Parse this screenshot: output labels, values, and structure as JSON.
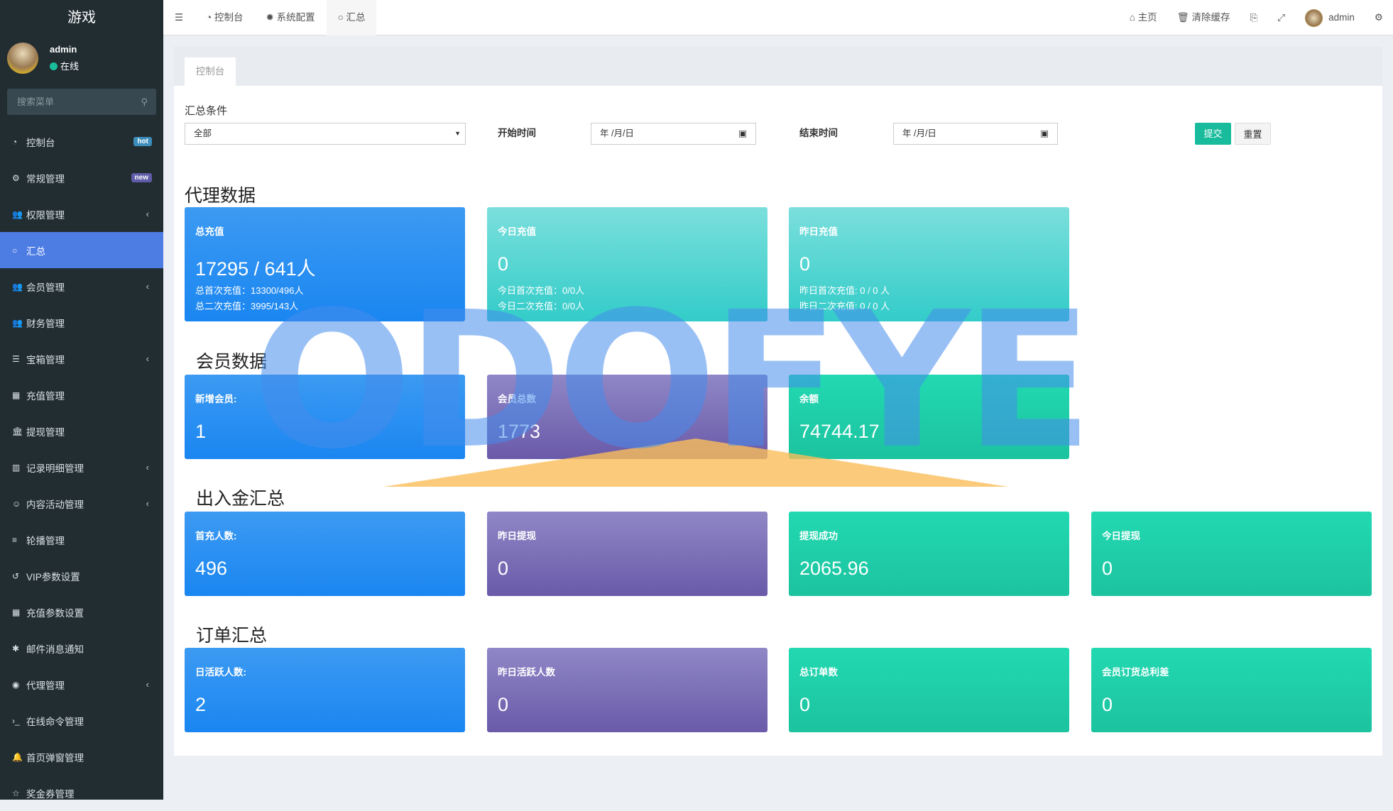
{
  "sidebar": {
    "app_title": "游戏",
    "user": "admin",
    "status": "在线",
    "search_placeholder": "搜索菜单",
    "items": [
      {
        "label": "控制台",
        "icon": "dashboard-icon",
        "badge": "hot",
        "badge_color": "#3c8dbc"
      },
      {
        "label": "常规管理",
        "icon": "cogs-icon",
        "badge": "new",
        "badge_color": "#605ca8"
      },
      {
        "label": "权限管理",
        "icon": "group-icon",
        "chevron": "‹"
      },
      {
        "label": "汇总",
        "icon": "circle-icon",
        "active": true
      },
      {
        "label": "会员管理",
        "icon": "users-icon",
        "chevron": "‹"
      },
      {
        "label": "财务管理",
        "icon": "users-icon"
      },
      {
        "label": "宝箱管理",
        "icon": "list-icon",
        "chevron": "‹"
      },
      {
        "label": "充值管理",
        "icon": "grid-icon"
      },
      {
        "label": "提现管理",
        "icon": "bank-icon"
      },
      {
        "label": "记录明细管理",
        "icon": "bar-chart-icon",
        "chevron": "‹"
      },
      {
        "label": "内容活动管理",
        "icon": "smile-icon",
        "chevron": "‹"
      },
      {
        "label": "轮播管理",
        "icon": "bars-icon"
      },
      {
        "label": "VIP参数设置",
        "icon": "history-icon"
      },
      {
        "label": "充值参数设置",
        "icon": "th-icon"
      },
      {
        "label": "邮件消息通知",
        "icon": "asterisk-icon"
      },
      {
        "label": "代理管理",
        "icon": "user-circle-icon",
        "chevron": "‹"
      },
      {
        "label": "在线命令管理",
        "icon": "terminal-icon"
      },
      {
        "label": "首页弹窗管理",
        "icon": "bell-icon"
      },
      {
        "label": "奖金券管理",
        "icon": "star-icon"
      }
    ]
  },
  "topbar": {
    "tabs": [
      {
        "label": "控制台"
      },
      {
        "label": "系统配置"
      },
      {
        "label": "汇总",
        "active": true
      }
    ],
    "home": "主页",
    "clear_cache": "清除缓存",
    "user": "admin"
  },
  "panel": {
    "tab": "控制台"
  },
  "filter": {
    "label": "汇总条件",
    "select_value": "全部",
    "start_label": "开始时间",
    "start_placeholder": "年 /月/日",
    "end_label": "结束时间",
    "end_placeholder": "年 /月/日",
    "submit": "提交",
    "reset": "重置"
  },
  "sections": {
    "agent": {
      "title": "代理数据",
      "cards": [
        {
          "title": "总充值",
          "value": "17295 / 641人",
          "sub1": "总首次充值：13300/496人",
          "sub2": "总二次充值：3995/143人"
        },
        {
          "title": "今日充值",
          "value": "0",
          "sub1": "今日首次充值：0/0人",
          "sub2": "今日二次充值：0/0人"
        },
        {
          "title": "昨日充值",
          "value": "0",
          "sub1": "昨日首次充值: 0 / 0 人",
          "sub2": "昨日二次充值: 0 / 0 人"
        }
      ]
    },
    "member": {
      "title": "会员数据",
      "cards": [
        {
          "title": "新增会员:",
          "value": "1"
        },
        {
          "title": "会员总数",
          "value": "1773"
        },
        {
          "title": "余额",
          "value": "74744.17"
        }
      ]
    },
    "cash": {
      "title": "出入金汇总",
      "cards": [
        {
          "title": "首充人数:",
          "value": "496"
        },
        {
          "title": "昨日提现",
          "value": "0"
        },
        {
          "title": "提现成功",
          "value": "2065.96"
        },
        {
          "title": "今日提现",
          "value": "0"
        }
      ]
    },
    "orders": {
      "title": "订单汇总",
      "cards": [
        {
          "title": "日活跃人数:",
          "value": "2"
        },
        {
          "title": "昨日活跃人数",
          "value": "0"
        },
        {
          "title": "总订单数",
          "value": "0"
        },
        {
          "title": "会员订货总利差",
          "value": "0"
        }
      ]
    }
  },
  "watermark": "ODOFYE"
}
